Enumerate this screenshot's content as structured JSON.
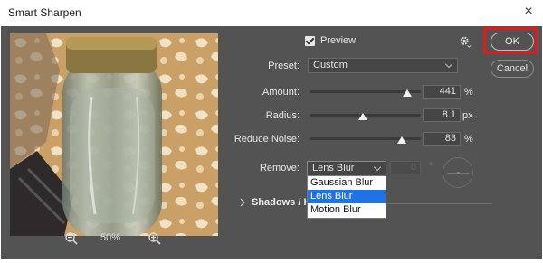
{
  "window": {
    "title": "Smart Sharpen",
    "close_glyph": "×"
  },
  "preview": {
    "label": "Preview",
    "checked": true,
    "zoom_value": "50%"
  },
  "preset": {
    "label": "Preset:",
    "value": "Custom"
  },
  "amount": {
    "label": "Amount:",
    "value": "441",
    "unit": "%",
    "slider_fraction": 0.88
  },
  "radius": {
    "label": "Radius:",
    "value": "8.1",
    "unit": "px",
    "slider_fraction": 0.48
  },
  "reduce_noise": {
    "label": "Reduce Noise:",
    "value": "83",
    "unit": "%",
    "slider_fraction": 0.83
  },
  "remove": {
    "label": "Remove:",
    "value": "Lens Blur",
    "angle_value": "0",
    "angle_unit": "°",
    "options": [
      "Gaussian Blur",
      "Lens Blur",
      "Motion Blur"
    ],
    "selected_index": 1
  },
  "shadows_highlights": {
    "label": "Shadows / H"
  },
  "buttons": {
    "ok": "OK",
    "cancel": "Cancel"
  },
  "colors": {
    "dialog_bg": "#535353",
    "ok_highlight": "#e01b1b",
    "selected_option": "#1e73e6"
  },
  "icons": {
    "gear": "gear-icon",
    "zoom_in": "zoom-in-icon",
    "zoom_out": "zoom-out-icon",
    "expand": "chevron-right-icon"
  }
}
